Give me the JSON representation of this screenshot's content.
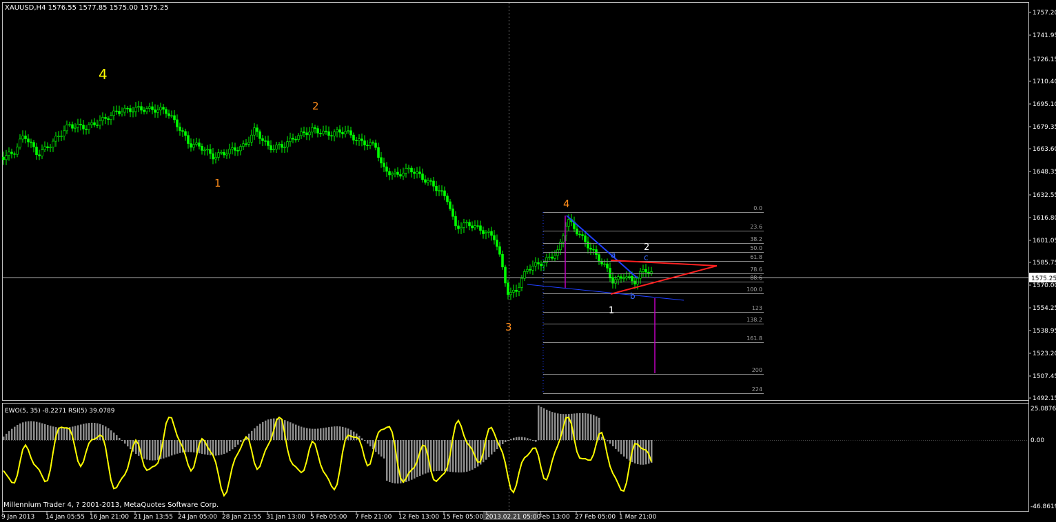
{
  "main_chart": {
    "header": "XAUUSD,H4  1576.55 1577.85 1575.00 1575.25",
    "bid_label": "1575.25",
    "price_scale": [
      "1757.20",
      "1741.95",
      "1726.15",
      "1710.40",
      "1695.10",
      "1679.35",
      "1663.60",
      "1648.35",
      "1632.55",
      "1616.80",
      "1601.05",
      "1585.75",
      "1570.00",
      "1554.25",
      "1538.95",
      "1523.20",
      "1507.45",
      "1492.15"
    ],
    "wave_labels": [
      {
        "text": "4",
        "color": "#ffff00"
      },
      {
        "text": "2",
        "color": "#ff8c1a"
      },
      {
        "text": "1",
        "color": "#ff8c1a"
      },
      {
        "text": "3",
        "color": "#ff8c1a"
      },
      {
        "text": "4",
        "color": "#ff8c1a"
      },
      {
        "text": "2",
        "color": "#ffffff"
      },
      {
        "text": "1",
        "color": "#ffffff"
      },
      {
        "text": "a",
        "color": "#3a6bff"
      },
      {
        "text": "b",
        "color": "#3a6bff"
      },
      {
        "text": "c",
        "color": "#3a6bff"
      }
    ],
    "fib_levels": [
      "0.0",
      "23.6",
      "38.2",
      "50.0",
      "61.8",
      "78.6",
      "88.6",
      "100.0",
      "123",
      "138.2",
      "161.8",
      "200",
      "224"
    ]
  },
  "indicator": {
    "header": "EWO(5, 35) -8.2271  RSI(5) 39.0789",
    "scale": [
      "25.0876",
      "0.00",
      "-46.8619"
    ],
    "copyright": "Millennium Trader 4, ? 2001-2013, MetaQuotes Software Corp."
  },
  "time_axis": [
    "9 Jan 2013",
    "14 Jan 05:55",
    "16 Jan 21:00",
    "21 Jan 13:55",
    "24 Jan 05:00",
    "28 Jan 21:55",
    "31 Jan 13:00",
    "5 Feb 05:00",
    "7 Feb 21:00",
    "12 Feb 13:00",
    "15 Feb 05:00",
    "2013.02.21 05:00",
    "Feb 13:00",
    "27 Feb 05:00",
    "1 Mar 21:00"
  ],
  "colors": {
    "background": "#000000",
    "candles": "#00ff00",
    "grid": "#c0c0c0",
    "fib": "#8a8a8a",
    "ewo_bars": "#8c8c8c",
    "rsi_line": "#ffff00",
    "trendline_red": "#ff2020",
    "trendline_blue": "#2040ff",
    "projection": "#c000c0"
  }
}
